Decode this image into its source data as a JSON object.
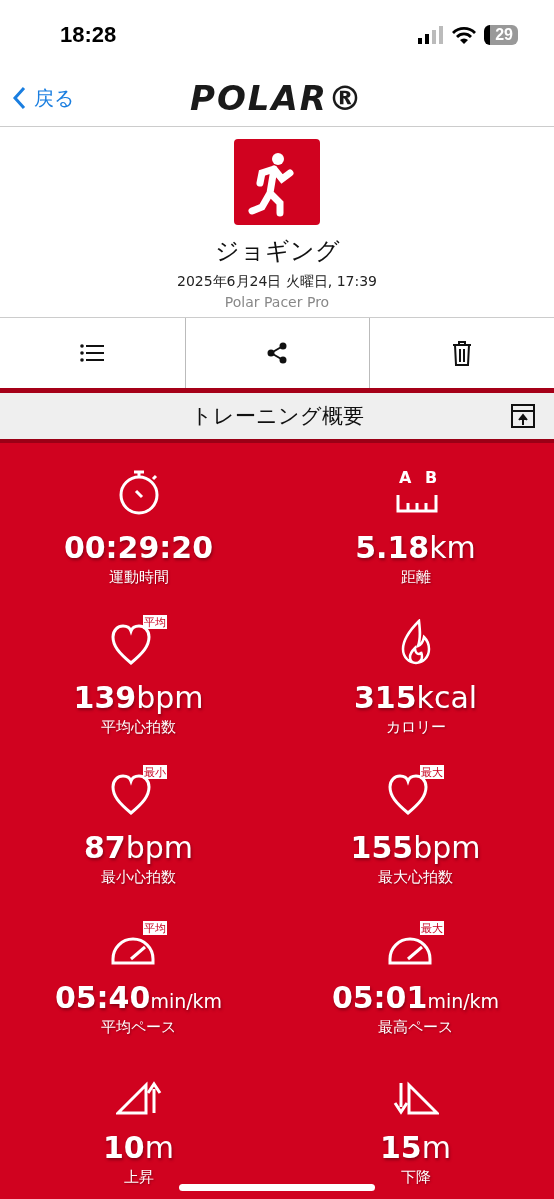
{
  "status_bar": {
    "time": "18:28",
    "battery": "29"
  },
  "nav": {
    "back": "戻る",
    "logo": "POLAR®"
  },
  "activity": {
    "title": "ジョギング",
    "date": "2025年6月24日 火曜日, 17:39",
    "device": "Polar Pacer Pro"
  },
  "toolbar": [
    {
      "kind": "list"
    },
    {
      "kind": "share"
    },
    {
      "kind": "delete"
    }
  ],
  "section": {
    "title": "トレーニング概要"
  },
  "distance_icon_marks": [
    "A",
    "B"
  ],
  "stats": [
    {
      "kind": "stopwatch",
      "value": "00:29:20",
      "label": "運動時間"
    },
    {
      "kind": "distance",
      "value": "5.18",
      "unit": "km",
      "label": "距離"
    },
    {
      "kind": "heart",
      "badge": "平均",
      "value": "139",
      "unit": "bpm",
      "label": "平均心拍数"
    },
    {
      "kind": "flame",
      "value": "315",
      "unit": "kcal",
      "label": "カロリー"
    },
    {
      "kind": "heart",
      "badge": "最小",
      "value": "87",
      "unit": "bpm",
      "label": "最小心拍数"
    },
    {
      "kind": "heart",
      "badge": "最大",
      "value": "155",
      "unit": "bpm",
      "label": "最大心拍数"
    },
    {
      "kind": "pace",
      "badge": "平均",
      "value": "05:40",
      "unit": "min/km",
      "label": "平均ペース"
    },
    {
      "kind": "pace",
      "badge": "最大",
      "value": "05:01",
      "unit": "min/km",
      "label": "最高ペース"
    },
    {
      "kind": "ascent",
      "value": "10",
      "unit": "m",
      "label": "上昇"
    },
    {
      "kind": "descent",
      "value": "15",
      "unit": "m",
      "label": "下降"
    }
  ]
}
